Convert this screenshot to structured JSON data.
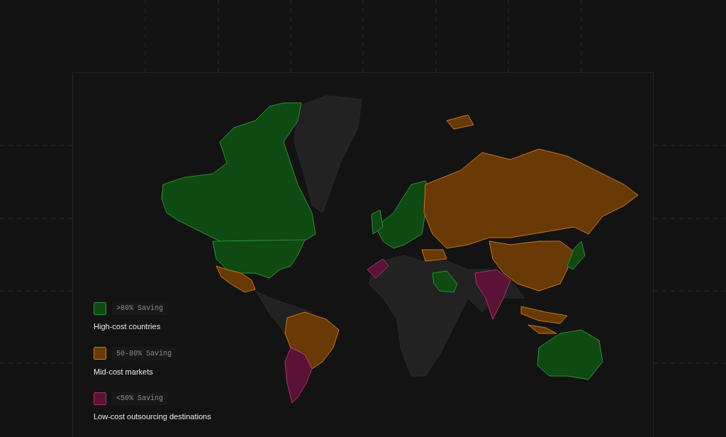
{
  "legend": [
    {
      "range": ">80% Saving",
      "label": "High-cost countries",
      "color": "#0f4a12"
    },
    {
      "range": "50-80% Saving",
      "label": "Mid-cost markets",
      "color": "#6a3a06"
    },
    {
      "range": "<50% Saving",
      "label": "Low-cost outsourcing destinations",
      "color": "#5a1236"
    }
  ]
}
